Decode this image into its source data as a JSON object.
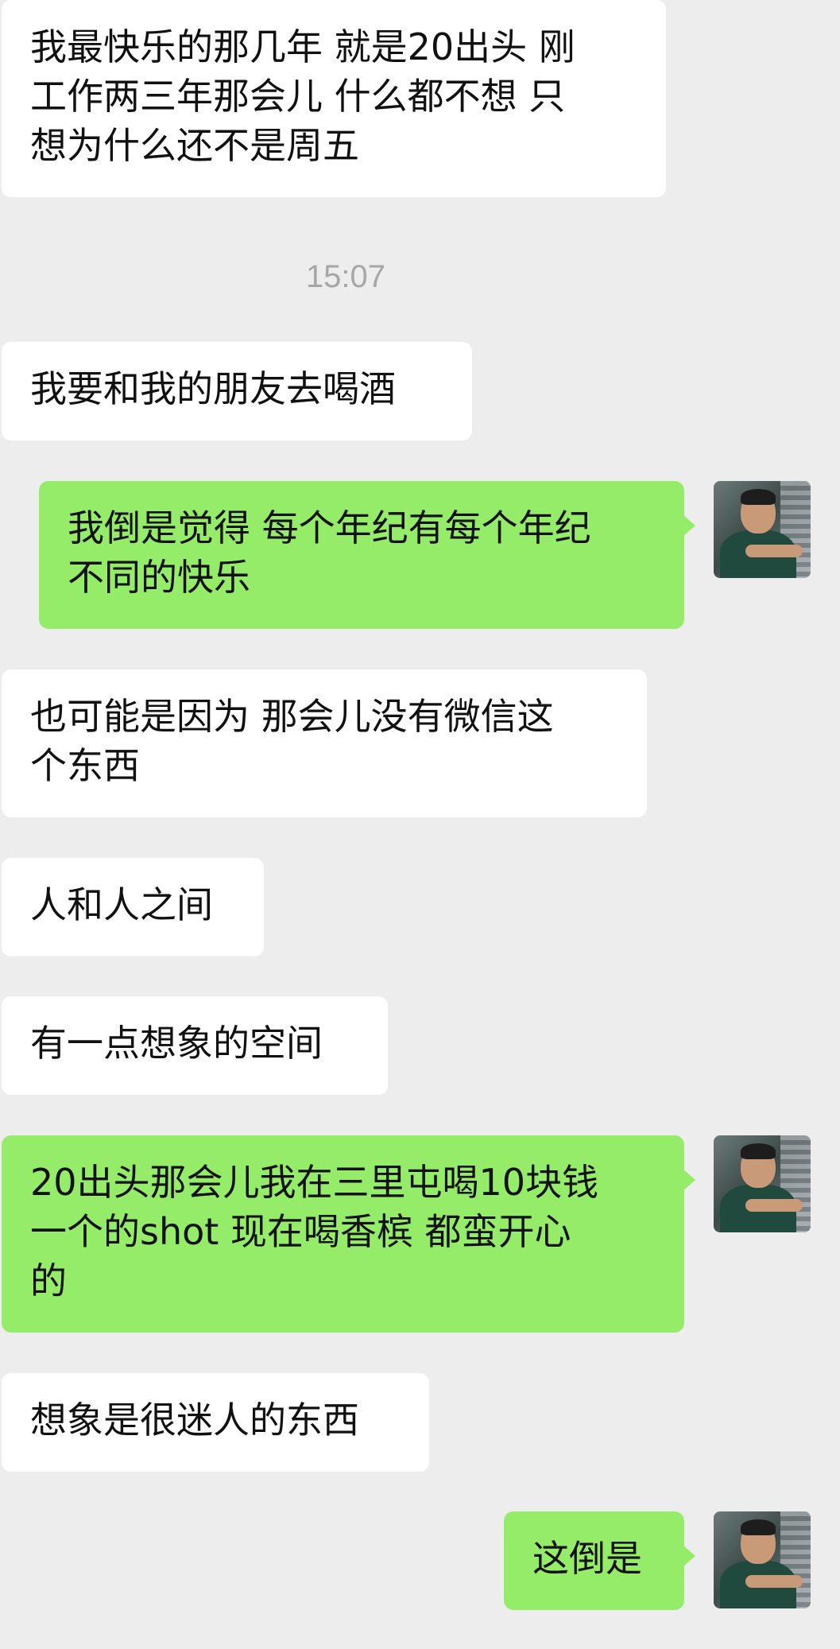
{
  "timestamp": "15:07",
  "messages": [
    {
      "side": "left",
      "text": "我最快乐的那几年 就是20出头 刚\n工作两三年那会儿 什么都不想 只\n想为什么还不是周五"
    },
    {
      "side": "left",
      "text": "我要和我的朋友去喝酒"
    },
    {
      "side": "right",
      "text": "我倒是觉得 每个年纪有每个年纪\n不同的快乐"
    },
    {
      "side": "left",
      "text": "也可能是因为 那会儿没有微信这\n个东西"
    },
    {
      "side": "left",
      "text": "人和人之间"
    },
    {
      "side": "left",
      "text": "有一点想象的空间"
    },
    {
      "side": "right",
      "text": "20出头那会儿我在三里屯喝10块钱\n一个的shot 现在喝香槟 都蛮开心\n的"
    },
    {
      "side": "left",
      "text": "想象是很迷人的东西"
    },
    {
      "side": "right",
      "text": "这倒是"
    }
  ]
}
